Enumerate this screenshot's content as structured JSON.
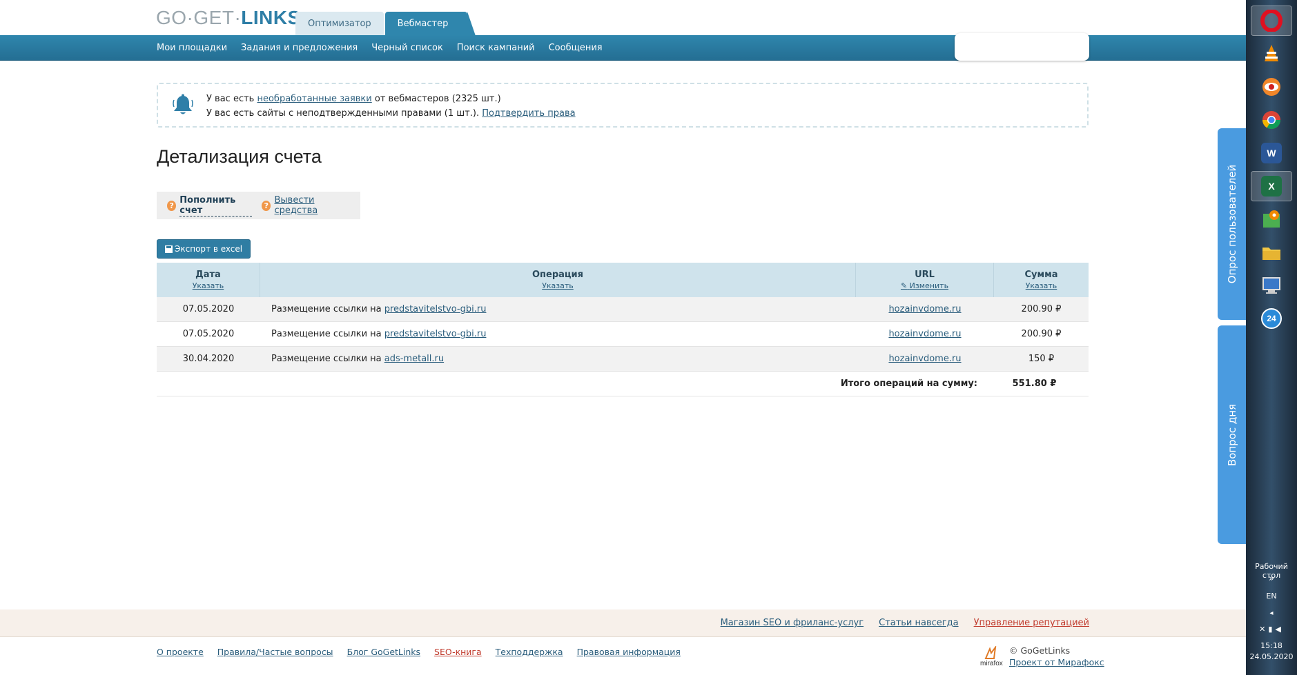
{
  "header": {
    "logo_part1": "GO·",
    "logo_part2": "GET·",
    "logo_part3": "LINKS",
    "tabs": [
      {
        "label": "Оптимизатор"
      },
      {
        "label": "Вебмастер"
      }
    ],
    "nav": [
      {
        "label": "Мои площадки"
      },
      {
        "label": "Задания и предложения"
      },
      {
        "label": "Черный список"
      },
      {
        "label": "Поиск кампаний"
      },
      {
        "label": "Сообщения"
      }
    ]
  },
  "notice": {
    "line1_prefix": "У вас есть ",
    "line1_link": "необработанные заявки",
    "line1_suffix": " от вебмастеров (2325 шт.)",
    "line2_prefix": "У вас есть сайты с неподтвержденными правами (1 шт.). ",
    "line2_link": "Подтвердить права"
  },
  "page_title": "Детализация счета",
  "actions": {
    "topup": "Пополнить счет",
    "withdraw": "Вывести средства"
  },
  "export_label": "Экспорт в excel",
  "table": {
    "columns": [
      {
        "title": "Дата",
        "sub": "Указать"
      },
      {
        "title": "Операция",
        "sub": "Указать"
      },
      {
        "title": "URL",
        "sub": "Изменить"
      },
      {
        "title": "Сумма",
        "sub": "Указать"
      }
    ],
    "rows": [
      {
        "date": "07.05.2020",
        "op_prefix": "Размещение ссылки на ",
        "op_link": "predstavitelstvo-gbi.ru",
        "url": "hozainvdome.ru",
        "sum": "200.90 ₽"
      },
      {
        "date": "07.05.2020",
        "op_prefix": "Размещение ссылки на ",
        "op_link": "predstavitelstvo-gbi.ru",
        "url": "hozainvdome.ru",
        "sum": "200.90 ₽"
      },
      {
        "date": "30.04.2020",
        "op_prefix": "Размещение ссылки на ",
        "op_link": "ads-metall.ru",
        "url": "hozainvdome.ru",
        "sum": "150 ₽"
      }
    ],
    "total_label": "Итого операций на сумму:",
    "total_value": "551.80 ₽"
  },
  "footer": {
    "top_links": [
      {
        "label": "Магазин SEO и фриланс-услуг"
      },
      {
        "label": "Статьи навсегда"
      },
      {
        "label": "Управление репутацией"
      }
    ],
    "bottom_links": [
      {
        "label": "О проекте"
      },
      {
        "label": "Правила/Частые вопросы"
      },
      {
        "label": "Блог GoGetLinks"
      },
      {
        "label": "SEO-книга"
      },
      {
        "label": "Техподдержка"
      },
      {
        "label": "Правовая информация"
      }
    ],
    "copyright": "© GoGetLinks",
    "project": "Проект от Мирафокс",
    "mirafox_logo": "mirafox"
  },
  "side_tabs": {
    "survey": "Опрос пользователей",
    "question": "Вопрос дня"
  },
  "taskbar": {
    "desktop_label": "Рабочий стол",
    "chevron": "»",
    "lang": "EN",
    "time": "15:18",
    "date": "24.05.2020",
    "badge_24": "24",
    "word_letter": "W",
    "excel_letter": "X"
  },
  "colors": {
    "nav_blue": "#2f86ad",
    "link": "#2a5d7c",
    "table_header": "#cfe3ec",
    "side_tab": "#4a9be0",
    "accent_orange": "#f0974a",
    "reputation_red": "#c0392b"
  }
}
